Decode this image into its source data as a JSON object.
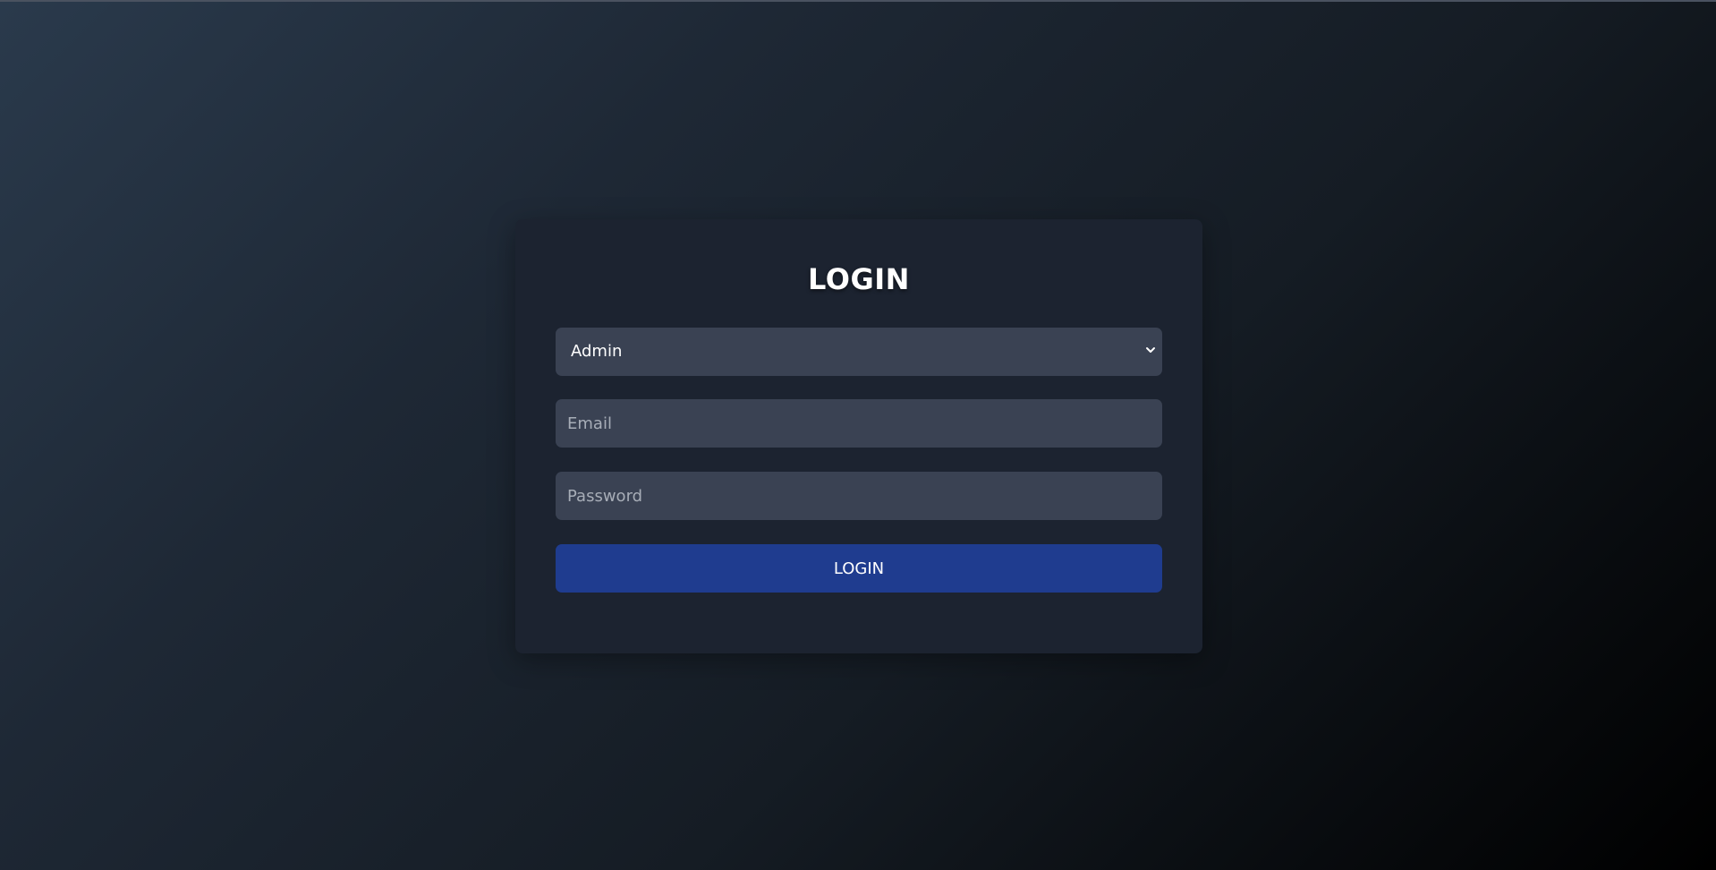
{
  "login": {
    "title": "LOGIN",
    "role_select": {
      "selected": "Admin"
    },
    "email": {
      "value": "",
      "placeholder": "Email"
    },
    "password": {
      "value": "",
      "placeholder": "Password"
    },
    "submit_label": "LOGIN"
  },
  "icons": {
    "select_arrow": "chevron-down-icon"
  },
  "colors": {
    "card_background": "#1c2330",
    "field_background": "#3a4253",
    "button_background": "#1f3c8f",
    "text": "#ffffff",
    "placeholder": "#a7adb7"
  }
}
